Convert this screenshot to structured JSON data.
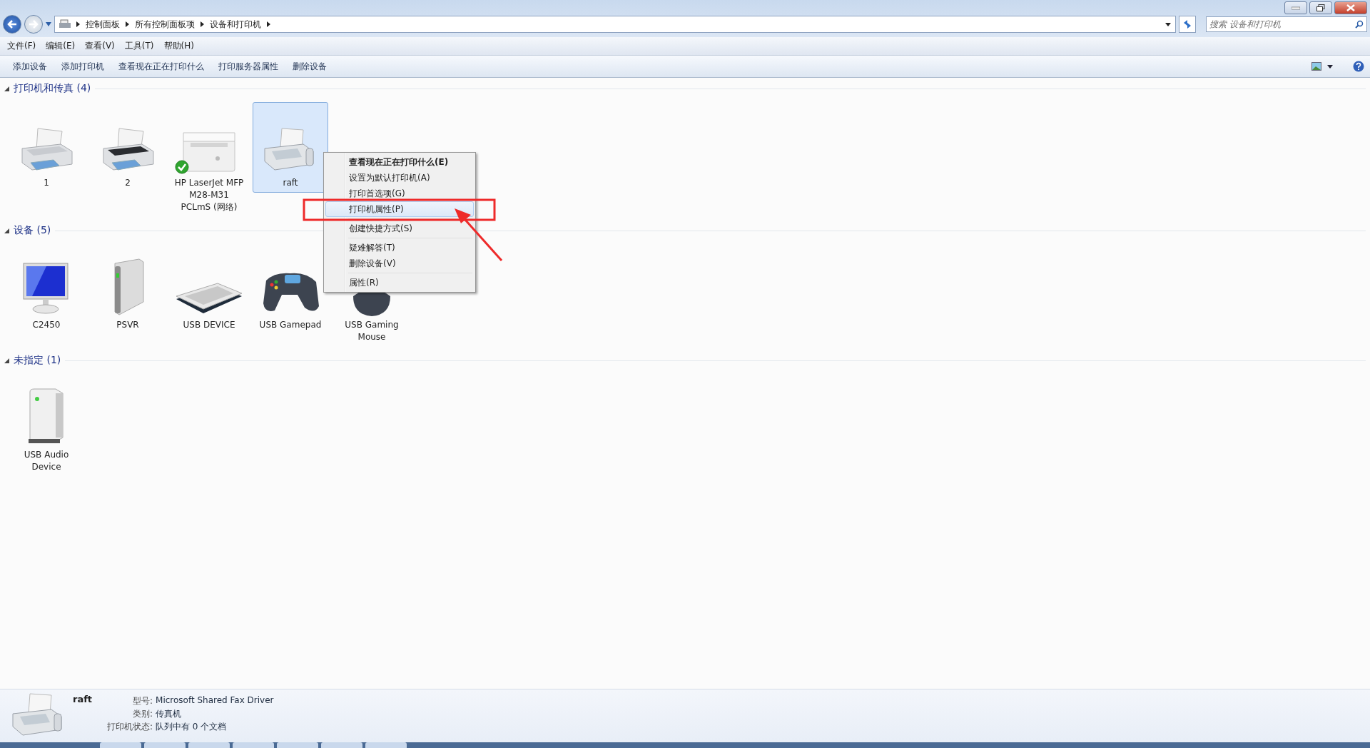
{
  "address_bar": {
    "path": [
      "控制面板",
      "所有控制面板项",
      "设备和打印机"
    ]
  },
  "search": {
    "placeholder": "搜索 设备和打印机"
  },
  "menu_bar": [
    "文件(F)",
    "编辑(E)",
    "查看(V)",
    "工具(T)",
    "帮助(H)"
  ],
  "toolbar": [
    "添加设备",
    "添加打印机",
    "查看现在正在打印什么",
    "打印服务器属性",
    "删除设备"
  ],
  "groups": [
    {
      "title": "打印机和传真 (4)",
      "items": [
        {
          "label": "1",
          "kind": "printer",
          "selected": false,
          "default": false
        },
        {
          "label": "2",
          "kind": "printer-dark",
          "selected": false,
          "default": false
        },
        {
          "label": "HP LaserJet MFP M28-M31 PCLmS (网络)",
          "kind": "laser",
          "selected": false,
          "default": true
        },
        {
          "label": "raft",
          "kind": "fax",
          "selected": true,
          "default": false
        }
      ]
    },
    {
      "title": "设备 (5)",
      "items": [
        {
          "label": "C2450",
          "kind": "monitor",
          "selected": false,
          "default": false
        },
        {
          "label": "PSVR",
          "kind": "drive",
          "selected": false,
          "default": false
        },
        {
          "label": "USB DEVICE",
          "kind": "keyboard",
          "selected": false,
          "default": false
        },
        {
          "label": "USB Gamepad",
          "kind": "gamepad",
          "selected": false,
          "default": false
        },
        {
          "label": "USB Gaming Mouse",
          "kind": "mouse",
          "selected": false,
          "default": false
        }
      ]
    },
    {
      "title": "未指定 (1)",
      "items": [
        {
          "label": "USB Audio Device",
          "kind": "box",
          "selected": false,
          "default": false
        }
      ]
    }
  ],
  "context_menu": [
    {
      "kind": "item",
      "label": "查看现在正在打印什么(E)",
      "bold": true,
      "selected": false
    },
    {
      "kind": "item",
      "label": "设置为默认打印机(A)",
      "bold": false,
      "selected": false
    },
    {
      "kind": "item",
      "label": "打印首选项(G)",
      "bold": false,
      "selected": false
    },
    {
      "kind": "item",
      "label": "打印机属性(P)",
      "bold": false,
      "selected": true
    },
    {
      "kind": "separator"
    },
    {
      "kind": "item",
      "label": "创建快捷方式(S)",
      "bold": false,
      "selected": false
    },
    {
      "kind": "separator"
    },
    {
      "kind": "item",
      "label": "疑难解答(T)",
      "bold": false,
      "selected": false
    },
    {
      "kind": "item",
      "label": "删除设备(V)",
      "bold": false,
      "selected": false
    },
    {
      "kind": "separator"
    },
    {
      "kind": "item",
      "label": "属性(R)",
      "bold": false,
      "selected": false
    }
  ],
  "details": {
    "name": "raft",
    "fields": [
      {
        "label": "型号:",
        "value": "Microsoft Shared Fax Driver"
      },
      {
        "label": "类别:",
        "value": "传真机"
      },
      {
        "label": "打印机状态:",
        "value": "队列中有 0 个文档"
      }
    ]
  }
}
